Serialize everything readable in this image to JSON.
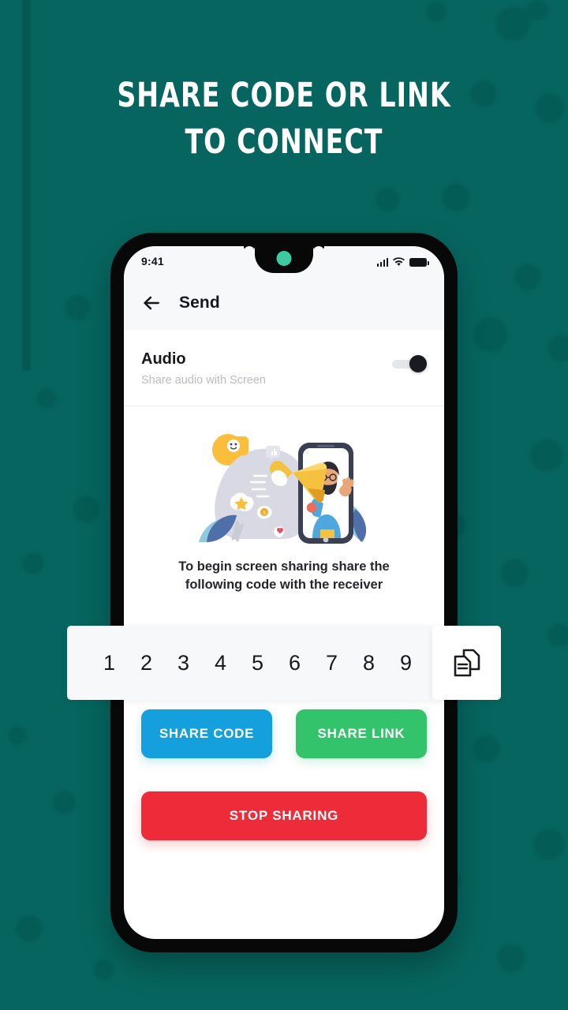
{
  "theme": {
    "background": "#06665F",
    "background_dot": "#045C56",
    "accent_blue": "#14A0DC",
    "accent_green": "#33C36B",
    "accent_red": "#EE2B38",
    "camera_dot": "#3EC9A0",
    "screen_bg": "#FFFFFF",
    "bar_bg": "#F7F8FA"
  },
  "headline": {
    "line1": "SHARE CODE OR LINK",
    "line2": "TO CONNECT"
  },
  "phone": {
    "status_bar": {
      "time": "9:41",
      "icons": [
        "signal-icon",
        "wifi-icon",
        "battery-icon"
      ]
    },
    "app_bar": {
      "back_icon": "arrow-left-icon",
      "title": "Send"
    },
    "audio_row": {
      "title": "Audio",
      "subtitle": "Share audio with Screen",
      "toggle_state": "on"
    },
    "illustration": {
      "name": "megaphone-announcement-illustration",
      "alt": "Man inside phone holding a megaphone"
    },
    "instruction": {
      "line1": "To begin screen sharing share the",
      "line2": "following code with the receiver"
    },
    "code": {
      "digits": [
        "1",
        "2",
        "3",
        "4",
        "5",
        "6",
        "7",
        "8",
        "9"
      ],
      "value": "123456789",
      "copy_icon": "copy-icon"
    },
    "buttons": {
      "share_code": "SHARE CODE",
      "share_link": "SHARE LINK",
      "stop_sharing": "STOP SHARING"
    }
  }
}
